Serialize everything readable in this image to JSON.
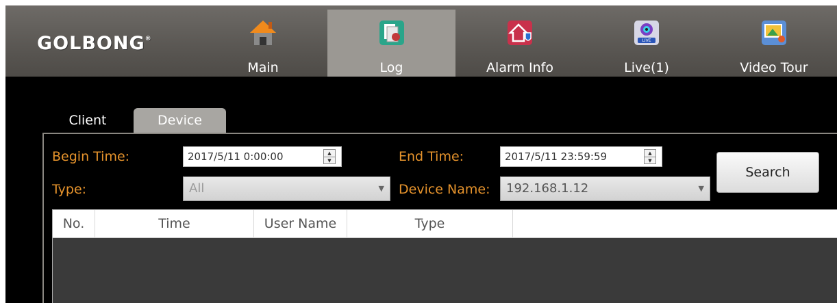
{
  "app": {
    "logo": "GOLBONG",
    "logo_mark": "®"
  },
  "nav": [
    {
      "label": "Main",
      "icon": "home-icon"
    },
    {
      "label": "Log",
      "icon": "log-icon",
      "active": true
    },
    {
      "label": "Alarm Info",
      "icon": "alarm-icon"
    },
    {
      "label": "Live(1)",
      "icon": "live-icon"
    },
    {
      "label": "Video Tour",
      "icon": "video-tour-icon"
    }
  ],
  "tabs": [
    {
      "label": "Client"
    },
    {
      "label": "Device",
      "active": true
    }
  ],
  "filters": {
    "begin_label": "Begin Time:",
    "begin_value": "2017/5/11 0:00:00",
    "end_label": "End Time:",
    "end_value": "2017/5/11 23:59:59",
    "type_label": "Type:",
    "type_value": "All",
    "device_label": "Device Name:",
    "device_value": "192.168.1.12",
    "search_label": "Search"
  },
  "table": {
    "columns": [
      "No.",
      "Time",
      "User Name",
      "Type"
    ]
  },
  "colors": {
    "accent": "#e6932c",
    "topbar": "#5b5854",
    "active_nav": "#9b9893"
  }
}
